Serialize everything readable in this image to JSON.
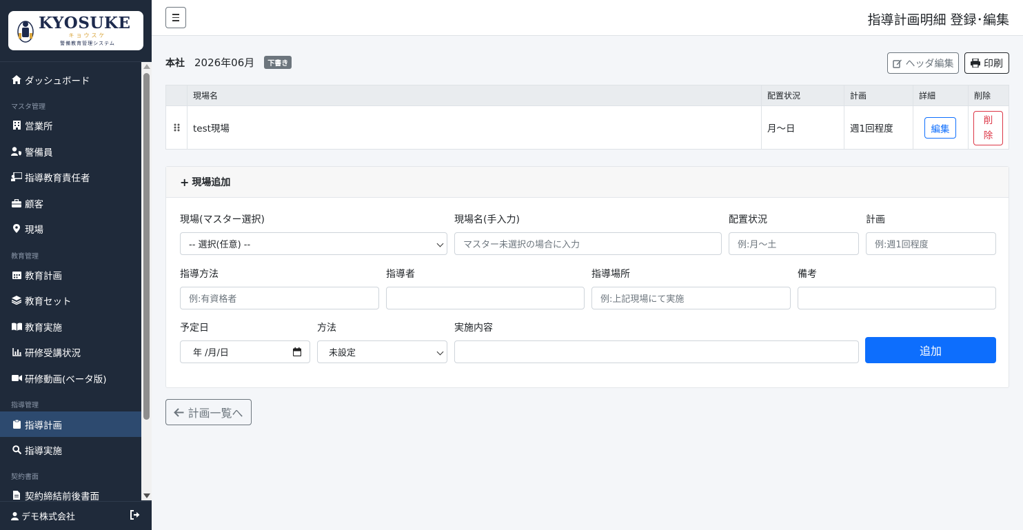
{
  "brand": {
    "name": "KYOSUKE",
    "kana": "キョウスケ",
    "subtitle": "警備教育管理システム"
  },
  "sidebar": {
    "items": [
      {
        "label": "ダッシュボード",
        "icon": "home-icon"
      },
      {
        "section": "マスタ管理"
      },
      {
        "label": "営業所",
        "icon": "building-icon"
      },
      {
        "label": "警備員",
        "icon": "user-shield-icon"
      },
      {
        "label": "指導教育責任者",
        "icon": "chalkboard-teacher-icon"
      },
      {
        "label": "顧客",
        "icon": "briefcase-icon"
      },
      {
        "label": "現場",
        "icon": "map-pin-icon"
      },
      {
        "section": "教育管理"
      },
      {
        "label": "教育計画",
        "icon": "calendar-icon"
      },
      {
        "label": "教育セット",
        "icon": "layers-icon"
      },
      {
        "label": "教育実施",
        "icon": "book-icon"
      },
      {
        "label": "研修受講状況",
        "icon": "chart-bar-icon"
      },
      {
        "label": "研修動画(ベータ版)",
        "icon": "video-icon"
      },
      {
        "section": "指導管理"
      },
      {
        "label": "指導計画",
        "icon": "clipboard-icon",
        "active": true
      },
      {
        "label": "指導実施",
        "icon": "search-icon"
      },
      {
        "section": "契約書面"
      },
      {
        "label": "契約締結前後書面",
        "icon": "file-icon"
      }
    ],
    "footer_user": "デモ株式会社"
  },
  "header": {
    "title": "指導計画明細 登録･編集"
  },
  "plan": {
    "office": "本社",
    "month": "2026年06月",
    "status_badge": "下書き",
    "header_edit_label": "ヘッダ編集",
    "print_label": "印刷"
  },
  "table": {
    "columns": [
      "現場名",
      "配置状況",
      "計画",
      "詳細",
      "削除"
    ],
    "rows": [
      {
        "site": "test現場",
        "placement": "月〜日",
        "plan": "週1回程度",
        "edit_label": "編集",
        "delete_label": "削\n除"
      }
    ]
  },
  "form": {
    "title": "現場追加",
    "site_master_label": "現場(マスター選択)",
    "site_master_value": "-- 選択(任意) --",
    "site_name_label": "現場名(手入力)",
    "site_name_placeholder": "マスター未選択の場合に入力",
    "placement_label": "配置状況",
    "placement_placeholder": "例:月〜土",
    "plan_label": "計画",
    "plan_placeholder": "例:週1回程度",
    "method_label": "指導方法",
    "method_placeholder": "例:有資格者",
    "instructor_label": "指導者",
    "instructor_placeholder": "",
    "location_label": "指導場所",
    "location_placeholder": "例:上記現場にて実施",
    "notes_label": "備考",
    "notes_placeholder": "",
    "date_label": "予定日",
    "date_value": "年 /月/日",
    "way_label": "方法",
    "way_value": "未設定",
    "content_label": "実施内容",
    "content_placeholder": "",
    "add_button": "追加"
  },
  "back_button": "計画一覧へ",
  "colors": {
    "sidebar_bg": "#1f2a3a",
    "active_item": "#2d4a6f",
    "primary": "#0d6efd",
    "danger": "#dc3545",
    "badge": "#6c757d"
  }
}
